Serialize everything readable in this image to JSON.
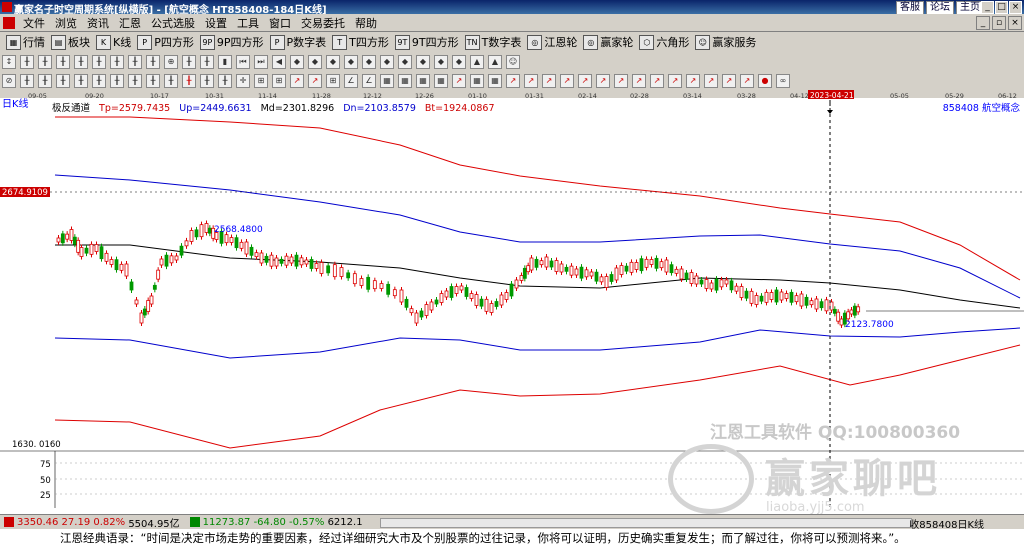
{
  "window": {
    "title": "赢家名子时空周期系统[纵横版] - [航空概念  HT858408-184日K线]",
    "links": [
      "客服",
      "论坛",
      "主页"
    ]
  },
  "menu": [
    "文件",
    "浏览",
    "资讯",
    "汇恩",
    "公式选股",
    "设置",
    "工具",
    "窗口",
    "交易委托",
    "帮助"
  ],
  "toolbar": [
    "行情",
    "板块",
    "K线",
    "P四方形",
    "9P四方形",
    "P数字表",
    "T四方形",
    "9T四方形",
    "T数字表",
    "江恩轮",
    "赢家轮",
    "六角形",
    "赢家服务"
  ],
  "chart": {
    "period_label": "日K线",
    "indicator_name": "极反通道",
    "tp": "Tp=2579.7435",
    "up": "Up=2449.6631",
    "md": "Md=2301.8296",
    "dn": "Dn=2103.8579",
    "bt": "Bt=1924.0867",
    "code_name": "858408  航空概念",
    "price_marker": "2674.9109",
    "high_label": "2568.4800",
    "low_label": "2123.7800",
    "lower_axis_top": "1630. 0160",
    "lower_axis_ticks": [
      "75",
      "50",
      "25"
    ],
    "cursor_date": "2023-04-21",
    "dates": [
      "09-05",
      "09-20",
      "10-17",
      "10-31",
      "11-14",
      "11-28",
      "12-12",
      "12-26",
      "01-10",
      "01-31",
      "02-14",
      "02-28",
      "03-14",
      "03-28",
      "04-12",
      "05-05",
      "05-29",
      "06-12"
    ]
  },
  "status": {
    "sh": "3350.46",
    "sh_change": "27.19 0.82%",
    "sh_amount": "5504.95亿",
    "sz": "11273.87",
    "sz_change": "-64.80 -0.57%",
    "sz_amount": "6212.1",
    "right": "收858408日K线"
  },
  "quote": "江恩经典语录：“时间是决定市场走势的重要因素，经过详细研究大市及个别股票的过往记录，你将可以证明，历史确实重复发生；而了解过往，你将可以预测将来。”。",
  "watermark": {
    "line1": "江恩工具软件  QQ:100800360",
    "line2": "赢家聊吧",
    "line3": "liaoba.yjj5.com"
  }
}
